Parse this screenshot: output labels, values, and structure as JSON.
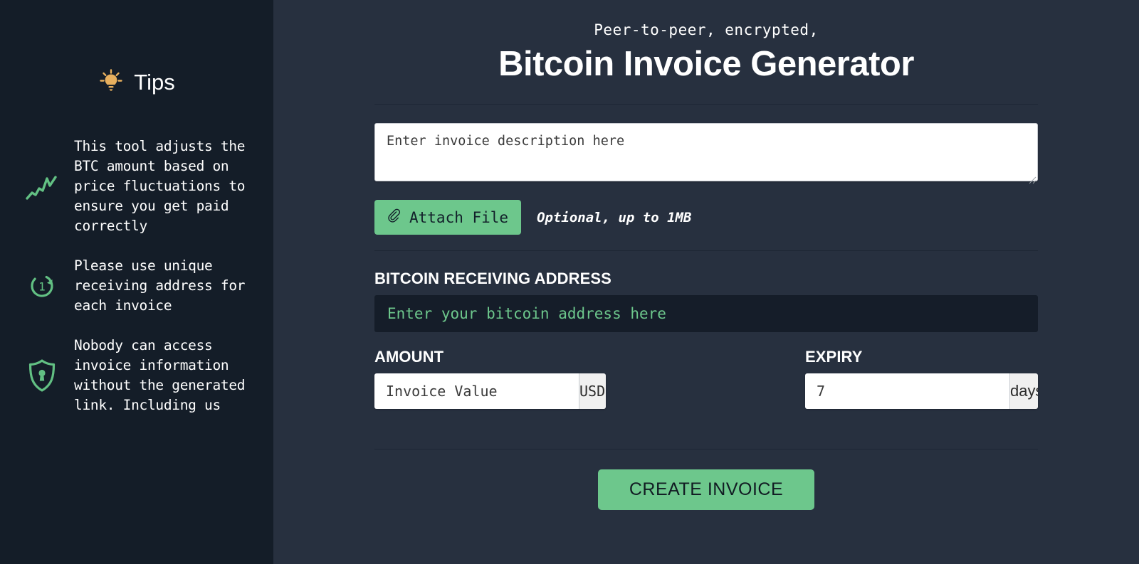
{
  "sidebar": {
    "heading": "Tips",
    "heading_icon": "lightbulb-icon",
    "tips": [
      {
        "icon": "trending-up-chart-icon",
        "text": "This tool adjusts the BTC amount based on price fluctuations to ensure you get paid correctly"
      },
      {
        "icon": "rotate-one-refresh-icon",
        "text": "Please use unique receiving address for each invoice"
      },
      {
        "icon": "shield-lock-icon",
        "text": "Nobody can access invoice information without the generated link. Including us"
      }
    ]
  },
  "header": {
    "eyebrow": "Peer-to-peer, encrypted,",
    "title": "Bitcoin Invoice Generator"
  },
  "description": {
    "placeholder": "Enter invoice description here",
    "value": ""
  },
  "attach": {
    "button_label": "Attach File",
    "button_icon": "paperclip-icon",
    "note": "Optional, up to 1MB"
  },
  "address": {
    "label": "BITCOIN RECEIVING ADDRESS",
    "placeholder": "Enter your bitcoin address here",
    "value": ""
  },
  "amount": {
    "label": "AMOUNT",
    "placeholder": "Invoice Value",
    "value": "",
    "currency": "USD",
    "currency_options": [
      "USD"
    ]
  },
  "expiry": {
    "label": "EXPIRY",
    "value": "7",
    "unit": "days"
  },
  "submit": {
    "label": "CREATE INVOICE"
  },
  "colors": {
    "sidebar_bg": "#141d28",
    "main_bg": "#27303f",
    "accent_green": "#6dc78c",
    "tip_icon_green": "#6dc78c",
    "bulb_amber": "#e8b05e",
    "address_field_bg": "#151d29",
    "divider": "#1d2634"
  }
}
